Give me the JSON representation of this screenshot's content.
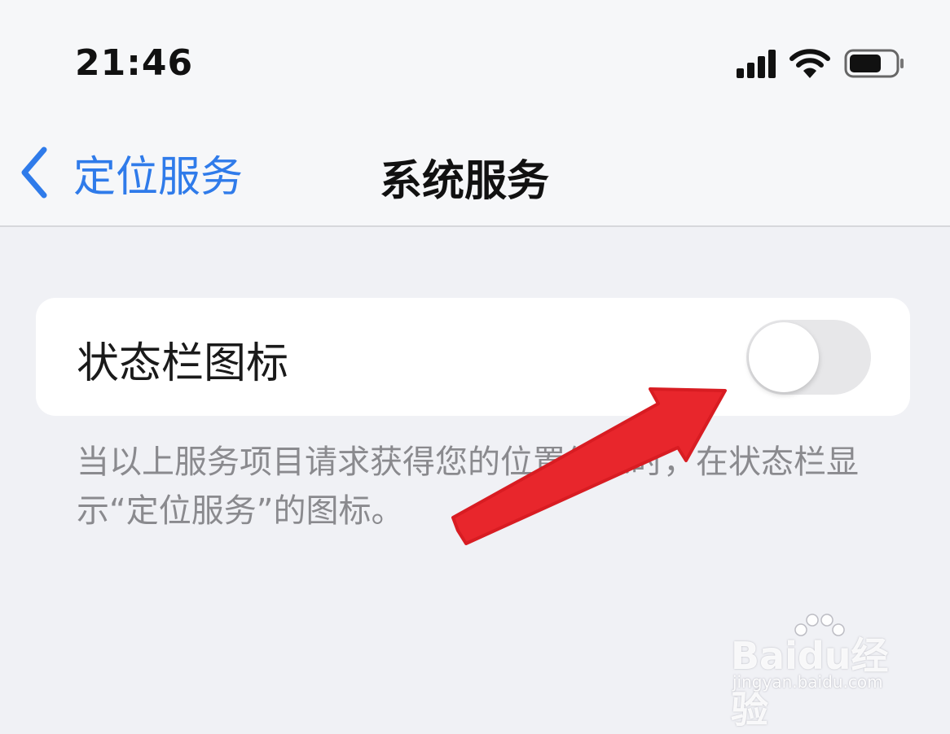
{
  "status_bar": {
    "time": "21:46",
    "icons": [
      "cellular-signal-icon",
      "wifi-icon",
      "battery-icon"
    ],
    "battery_level": 0.7
  },
  "nav": {
    "back_label": "定位服务",
    "title": "系统服务"
  },
  "setting": {
    "label": "状态栏图标",
    "toggle_on": false
  },
  "footnote": "当以上服务项目请求获得您的位置信息时，在状态栏显示“定位服务”的图标。",
  "annotation": {
    "arrow_color": "#e8262c"
  },
  "watermark": {
    "logo": "Baidu经验",
    "url": "jingyan.baidu.com"
  },
  "colors": {
    "accent": "#2f7bea",
    "background": "#f0f1f5",
    "toggle_off": "#e7e7e9"
  }
}
